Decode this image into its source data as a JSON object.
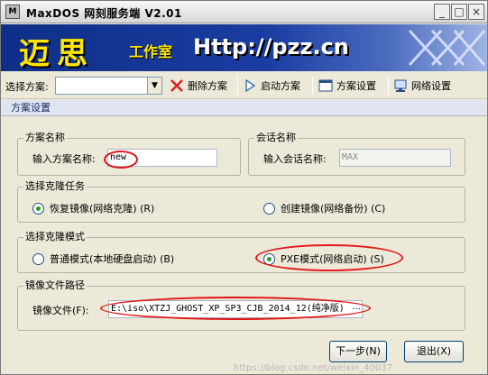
{
  "window": {
    "title": "MaxDOS 网刻服务端 V2.01",
    "app_icon_text": "M",
    "minimize_glyph": "_",
    "maximize_glyph": "□",
    "close_glyph": "×"
  },
  "banner": {
    "logo_text": "迈思",
    "studio_text": "工作室",
    "url_text": "Http://pzz.cn"
  },
  "toolbar": {
    "scheme_label": "选择方案:",
    "scheme_value": "",
    "delete_label": "删除方案",
    "start_label": "启动方案",
    "settings_label": "方案设置",
    "network_label": "网络设置",
    "icons": {
      "delete": "x-icon",
      "start": "play-icon",
      "settings": "window-icon",
      "network": "network-icon"
    }
  },
  "section_header": "方案设置",
  "scheme_name": {
    "group_title": "方案名称",
    "field_label": "输入方案名称:",
    "value": "new"
  },
  "session_name": {
    "group_title": "会话名称",
    "field_label": "输入会话名称:",
    "value": "MAX"
  },
  "clone_task": {
    "group_title": "选择克隆任务",
    "options": [
      {
        "label": "恢复镜像(网络克隆) (R)",
        "selected": true
      },
      {
        "label": "创建镜像(网络备份) (C)",
        "selected": false
      }
    ]
  },
  "clone_mode": {
    "group_title": "选择克隆模式",
    "options": [
      {
        "label": "普通模式(本地硬盘启动) (B)",
        "selected": false
      },
      {
        "label": "PXE模式(网络启动) (S)",
        "selected": true
      }
    ]
  },
  "image_path": {
    "group_title": "镜像文件路径",
    "field_label": "镜像文件(F):",
    "value": "E:\\iso\\XTZJ_GHOST_XP_SP3_CJB_2014_12(纯净版)",
    "browse_label": "..."
  },
  "buttons": {
    "next": "下一步(N)",
    "exit": "退出(X)"
  },
  "watermark": "https://blog.csdn.net/weixin_40037"
}
